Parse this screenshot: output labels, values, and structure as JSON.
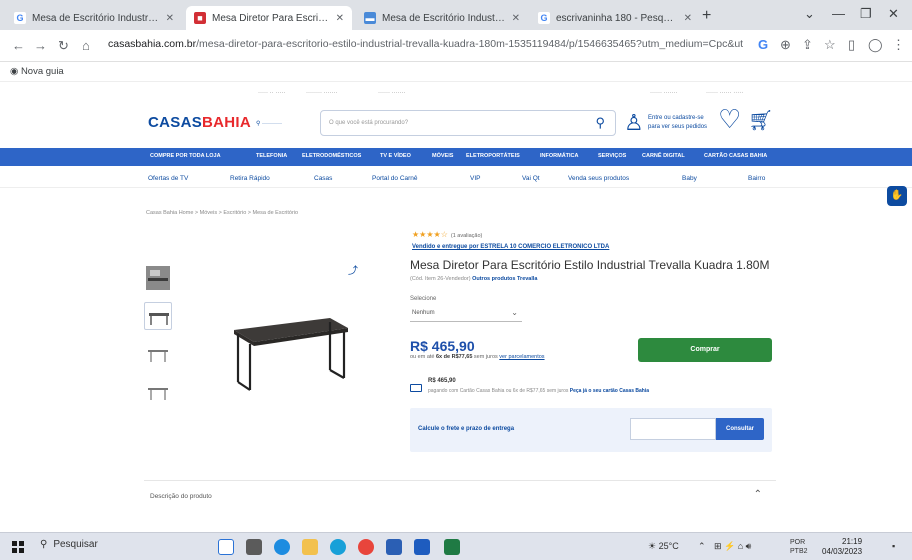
{
  "browser": {
    "tabs": [
      {
        "label": "Mesa de Escritório Industrial Ku",
        "icon": "google-icon",
        "active": false
      },
      {
        "label": "Mesa Diretor Para Escritório Esti",
        "icon": "casasbahia-icon",
        "active": true
      },
      {
        "label": "Mesa de Escritório Industrial Ku",
        "icon": "bookmark-site-icon",
        "active": false
      },
      {
        "label": "escrivaninha 180 - Pesquisa Go",
        "icon": "google-icon",
        "active": false
      }
    ],
    "new_tab": "+",
    "url_host": "casasbahia.com.br",
    "url_path": "/mesa-diretor-para-escritorio-estilo-industrial-trevalla-kuadra-180m-1535119484/p/1546635465?utm_medium=Cpc&ut",
    "bookmark": "Nova guia"
  },
  "site": {
    "logo_part1": "CASAS",
    "logo_part2": "BAHIA",
    "search_placeholder": "O que você está procurando?",
    "login_line1": "Entre ou cadastre-se",
    "login_line2": "para ver seus pedidos",
    "main_nav": [
      "COMPRE POR TODA LOJA",
      "TELEFONIA",
      "ELETRODOMÉSTICOS",
      "TV E VÍDEO",
      "MÓVEIS",
      "ELETROPORTÁTEIS",
      "INFORMÁTICA",
      "SERVIÇOS",
      "CARNÊ DIGITAL",
      "CARTÃO CASAS BAHIA"
    ],
    "sub_nav": [
      "Ofertas de TV",
      "Retira Rápido",
      "Casas",
      "Portal do Carnê",
      "VIP",
      "Vai Qt",
      "Venda seus produtos",
      "Baby",
      "Bairro"
    ],
    "breadcrumb": "Casas Bahia Home > Móveis > Escritório > Mesa de Escritório"
  },
  "product": {
    "stars": "★★★★☆",
    "review_count": "(1 avaliação)",
    "sold_by": "Vendido e entregue por ESTRELA 10 COMERCIO ELETRONICO LTDA",
    "title": "Mesa Diretor Para Escritório Estilo Industrial Trevalla Kuadra 1.80M",
    "code_prefix": "(Cód. Item 26-Vendedor)",
    "more_link": "Outros produtos Trevalla",
    "select_label": "Selecione",
    "select_value": "Nenhum",
    "price": "R$ 465,90",
    "installments_prefix": "ou em até",
    "installments_value": "6x de R$77,65",
    "installments_suffix": "sem juros",
    "installments_link": "ver parcelamentos",
    "buy_label": "Comprar",
    "card_price": "R$ 465,90",
    "card_text": "pagando com Cartão Casas Bahia ou 6x de R$77,65 sem juros",
    "card_link": "Peça já o seu cartão Casas Bahia",
    "shipping_label": "Calcule o frete e prazo de entrega",
    "cep_value": "",
    "consult_label": "Consultar",
    "description_label": "Descrição do produto"
  },
  "taskbar": {
    "search_placeholder": "Pesquisar",
    "weather": "25°C",
    "language": "POR",
    "language_sub": "PTB2",
    "time": "21:19",
    "date": "04/03/2023"
  }
}
